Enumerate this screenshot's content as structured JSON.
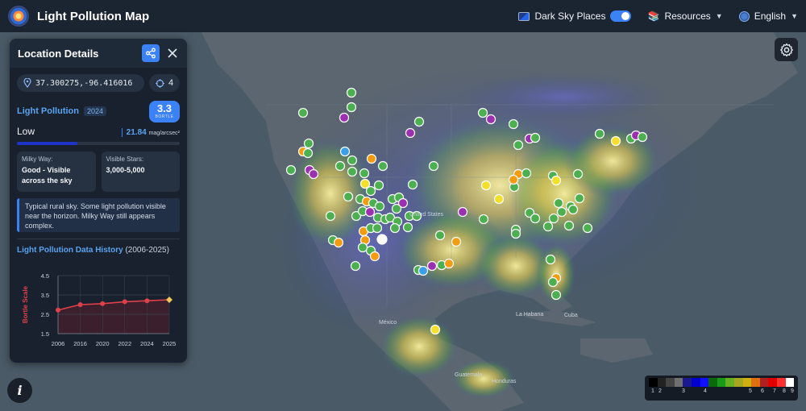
{
  "app": {
    "title": "Light Pollution Map"
  },
  "header": {
    "dark_sky_label": "Dark Sky Places",
    "dark_sky_enabled": true,
    "resources_label": "Resources",
    "language_label": "English"
  },
  "panel": {
    "title": "Location Details",
    "coordinates": "37.300275,-96.416016",
    "zoom": "4",
    "light_pollution_label": "Light Pollution",
    "year": "2024",
    "bortle_value": "3.3",
    "bortle_label": "BORTLE",
    "level": "Low",
    "mag_value": "21.84",
    "mag_unit": "mag/arcsec²",
    "darkness_fraction": 0.37,
    "milky_way_label": "Milky Way:",
    "milky_way_value": "Good - Visible across the sky",
    "visible_stars_label": "Visible Stars:",
    "visible_stars_value": "3,000-5,000",
    "description": "Typical rural sky. Some light pollution visible near the horizon. Milky Way still appears complex.",
    "history_title": "Light Pollution Data History",
    "history_range": "(2006-2025)"
  },
  "chart_data": {
    "type": "line",
    "x": [
      "2006",
      "2016",
      "2020",
      "2022",
      "2024",
      "2025"
    ],
    "values": [
      2.72,
      3.0,
      3.05,
      3.15,
      3.2,
      3.25
    ],
    "ylabel": "Bortle Scale",
    "ylim": [
      1.5,
      4.5
    ],
    "yticks": [
      "4.5",
      "3.5",
      "2.5",
      "1.5"
    ],
    "grid": true,
    "colors": {
      "line": "#e0404a",
      "last_point": "#f5c65a"
    }
  },
  "map": {
    "labels": [
      "United States",
      "México",
      "Cuba",
      "La Habana",
      "Guatemala",
      "Honduras"
    ]
  },
  "legend": {
    "colors": [
      "#000000",
      "#222222",
      "#444444",
      "#707070",
      "#1a1a8c",
      "#0000cc",
      "#1010ff",
      "#0a6a0a",
      "#1a9a1a",
      "#66b022",
      "#a8a820",
      "#d0b010",
      "#e07010",
      "#b02020",
      "#e00000",
      "#ff3030",
      "#ffffff"
    ],
    "labels": [
      "1",
      "2",
      "3",
      "4",
      "5",
      "6",
      "7",
      "8",
      "9"
    ]
  }
}
